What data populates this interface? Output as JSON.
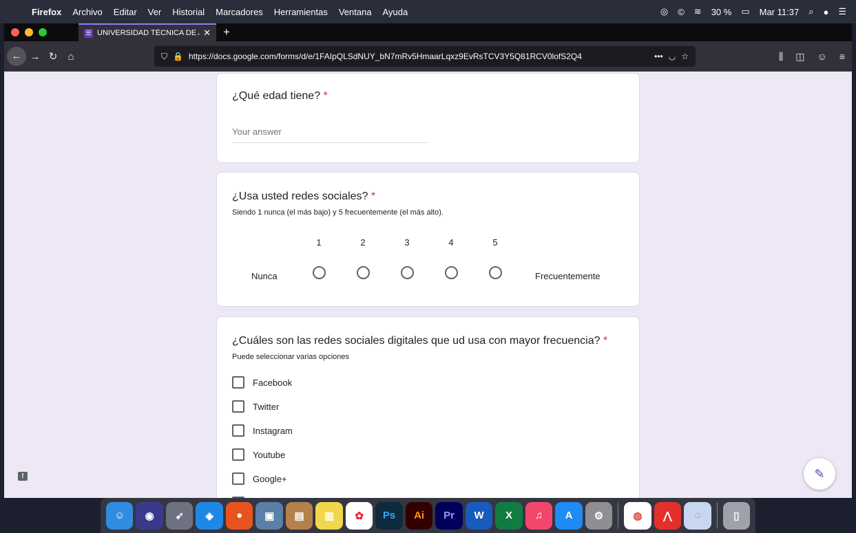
{
  "menubar": {
    "apple": "",
    "items": [
      "Firefox",
      "Archivo",
      "Editar",
      "Ver",
      "Historial",
      "Marcadores",
      "Herramientas",
      "Ventana",
      "Ayuda"
    ],
    "battery": "30 %",
    "clock": "Mar 11:37"
  },
  "browser": {
    "tab_title": "UNIVERSIDAD TÉCNICA DE AM",
    "tab_close": "✕",
    "new_tab": "+",
    "url": "https://docs.google.com/forms/d/e/1FAIpQLSdNUY_bN7mRv5HmaarLqxz9EvRsTCV3Y5Q81RCV0lofS2Q4",
    "page_actions": "•••"
  },
  "form": {
    "q1": {
      "title": "¿Qué edad tiene?",
      "required": "*",
      "placeholder": "Your answer"
    },
    "q2": {
      "title": "¿Usa usted redes sociales?",
      "required": "*",
      "description": "Siendo 1 nunca (el más bajo) y 5 frecuentemente (el más alto).",
      "scale": [
        "1",
        "2",
        "3",
        "4",
        "5"
      ],
      "min_label": "Nunca",
      "max_label": "Frecuentemente"
    },
    "q3": {
      "title": "¿Cuáles son las redes sociales digitales que ud usa con mayor frecuencia?",
      "required": "*",
      "description": "Puede seleccionar varias opciones",
      "options": [
        "Facebook",
        "Twitter",
        "Instagram",
        "Youtube",
        "Google+"
      ]
    }
  },
  "dock": {
    "labels": [
      "Ps",
      "Ai",
      "Pr",
      "W",
      "X"
    ]
  },
  "colors": {
    "page_bg": "#ede7f6",
    "accent": "#673ab7",
    "required": "#d93025"
  }
}
